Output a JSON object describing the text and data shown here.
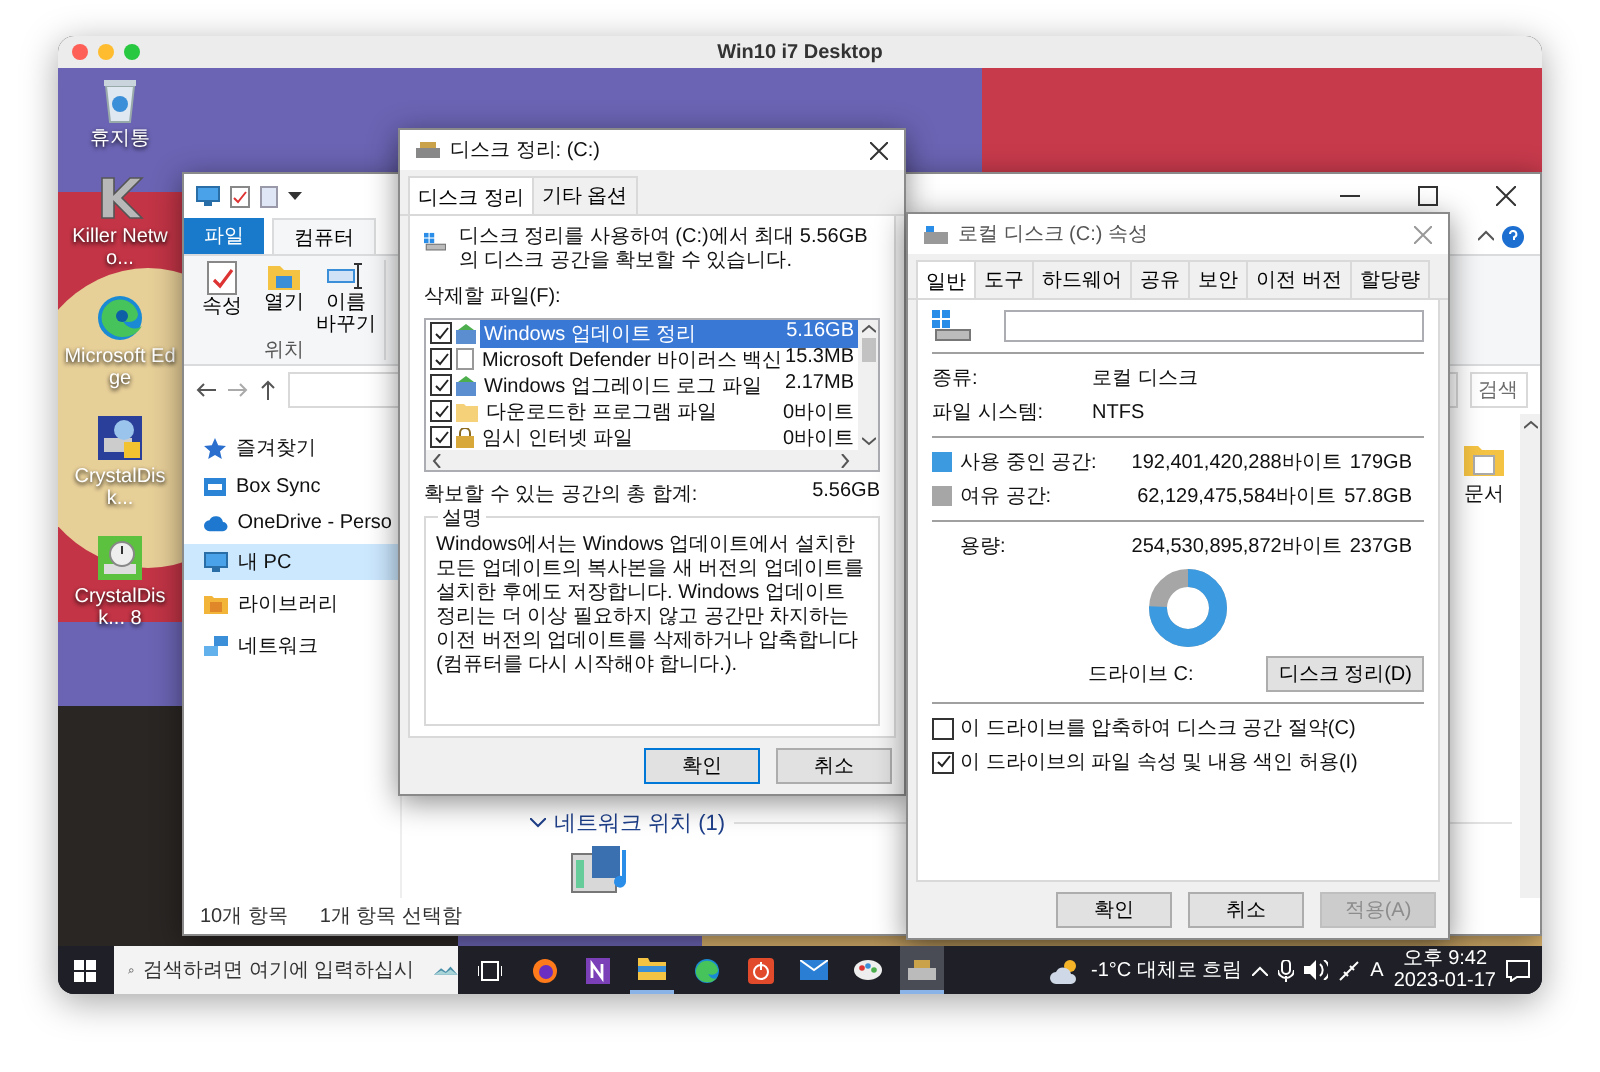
{
  "window": {
    "title": "Win10 i7 Desktop"
  },
  "desktop_icons": [
    {
      "label": "휴지통",
      "kind": "recycle-bin"
    },
    {
      "label": "Killer Netwo...",
      "kind": "killer"
    },
    {
      "label": "Microsoft Edge",
      "kind": "edge"
    },
    {
      "label": "CrystalDisk...",
      "kind": "crystal-info"
    },
    {
      "label": "CrystalDisk... 8",
      "kind": "crystal-mark"
    }
  ],
  "explorer": {
    "ribbon_tabs": [
      {
        "label": "파일",
        "kind": "file",
        "selected": false
      },
      {
        "label": "컴퓨터",
        "kind": "tab",
        "selected": true
      }
    ],
    "ribbon_buttons": [
      {
        "label": "속성",
        "kind": "properties"
      },
      {
        "label": "열기",
        "kind": "open"
      },
      {
        "label": "이름 바꾸기",
        "kind": "rename"
      }
    ],
    "ribbon_group": "위치",
    "search": {
      "placeholder": "검색"
    },
    "nav_items": [
      {
        "label": "즐겨찾기",
        "kind": "star",
        "selected": false
      },
      {
        "label": "Box Sync",
        "kind": "box",
        "selected": false
      },
      {
        "label": "OneDrive - Perso",
        "kind": "cloud",
        "selected": false
      },
      {
        "label": "내 PC",
        "kind": "pc",
        "selected": true
      },
      {
        "label": "라이브러리",
        "kind": "library",
        "selected": false
      },
      {
        "label": "네트워크",
        "kind": "network",
        "selected": false
      }
    ],
    "folder_item": "문서",
    "network_section": "네트워크 위치 (1)",
    "status": [
      "10개 항목",
      "1개 항목 선택함"
    ]
  },
  "cleanup": {
    "title": "디스크 정리: (C:)",
    "tabs": [
      {
        "label": "디스크 정리",
        "selected": true
      },
      {
        "label": "기타 옵션",
        "selected": false
      }
    ],
    "intro": "디스크 정리를 사용하여 (C:)에서 최대 5.56GB의 디스크 공간을 확보할 수 있습니다.",
    "files_label": "삭제할 파일(F):",
    "files": [
      {
        "name": "Windows 업데이트 정리",
        "size": "5.16GB",
        "kind": "update",
        "checked": true,
        "selected": true
      },
      {
        "name": "Microsoft Defender 바이러스 백신",
        "size": "15.3MB",
        "kind": "doc",
        "checked": true,
        "selected": false
      },
      {
        "name": "Windows 업그레이드 로그 파일",
        "size": "2.17MB",
        "kind": "update",
        "checked": true,
        "selected": false
      },
      {
        "name": "다운로드한 프로그램 파일",
        "size": "0바이트",
        "kind": "folder",
        "checked": true,
        "selected": false
      },
      {
        "name": "임시 인터넷 파일",
        "size": "0바이트",
        "kind": "lock",
        "checked": true,
        "selected": false
      }
    ],
    "total_label": "확보할 수 있는 공간의 총 합계:",
    "total": "5.56GB",
    "description_title": "설명",
    "description": "Windows에서는 Windows 업데이트에서 설치한 모든 업데이트의 복사본을 새 버전의 업데이트를 설치한 후에도 저장합니다. Windows 업데이트 정리는 더 이상 필요하지 않고 공간만 차지하는 이전 버전의 업데이트를 삭제하거나 압축합니다(컴퓨터를 다시 시작해야 합니다.).",
    "buttons": [
      {
        "label": "확인",
        "default": true
      },
      {
        "label": "취소",
        "default": false
      }
    ]
  },
  "properties": {
    "title": "로컬 디스크 (C:) 속성",
    "tabs": [
      {
        "label": "일반",
        "selected": true
      },
      {
        "label": "도구",
        "selected": false
      },
      {
        "label": "하드웨어",
        "selected": false
      },
      {
        "label": "공유",
        "selected": false
      },
      {
        "label": "보안",
        "selected": false
      },
      {
        "label": "이전 버전",
        "selected": false
      },
      {
        "label": "할당량",
        "selected": false
      }
    ],
    "type_label": "종류:",
    "type": "로컬 디스크",
    "fs_label": "파일 시스템:",
    "fs": "NTFS",
    "spaces": [
      {
        "label": "사용 중인 공간:",
        "bytes": "192,401,420,288바이트",
        "size": "179GB",
        "color": "#3c9be0"
      },
      {
        "label": "여유 공간:",
        "bytes": "62,129,475,584바이트",
        "size": "57.8GB",
        "color": "#a6a6a6"
      }
    ],
    "capacity": {
      "label": "용량:",
      "bytes": "254,530,895,872바이트",
      "size": "237GB"
    },
    "drive_label": "드라이브 C:",
    "cleanup_button": "디스크 정리(D)",
    "options": [
      {
        "label": "이 드라이브를 압축하여 디스크 공간 절약(C)",
        "checked": false
      },
      {
        "label": "이 드라이브의 파일 속성 및 내용 색인 허용(I)",
        "checked": true
      }
    ],
    "buttons": [
      {
        "label": "확인",
        "disabled": false
      },
      {
        "label": "취소",
        "disabled": false
      },
      {
        "label": "적용(A)",
        "disabled": true
      }
    ]
  },
  "taskbar": {
    "search_placeholder": "검색하려면 여기에 입력하십시",
    "apps": [
      {
        "kind": "task-view",
        "running": false,
        "selected": false
      },
      {
        "kind": "firefox",
        "running": false,
        "selected": false
      },
      {
        "kind": "onenote",
        "running": false,
        "selected": false
      },
      {
        "kind": "explorer",
        "running": true,
        "selected": false
      },
      {
        "kind": "edge",
        "running": false,
        "selected": false
      },
      {
        "kind": "power",
        "running": false,
        "selected": false
      },
      {
        "kind": "mail",
        "running": false,
        "selected": false
      },
      {
        "kind": "paint",
        "running": false,
        "selected": false
      },
      {
        "kind": "cleanup",
        "running": true,
        "selected": true
      }
    ],
    "weather": "-1°C 대체로 흐림",
    "ime": "A",
    "time": "오후 9:42",
    "date": "2023-01-17"
  }
}
